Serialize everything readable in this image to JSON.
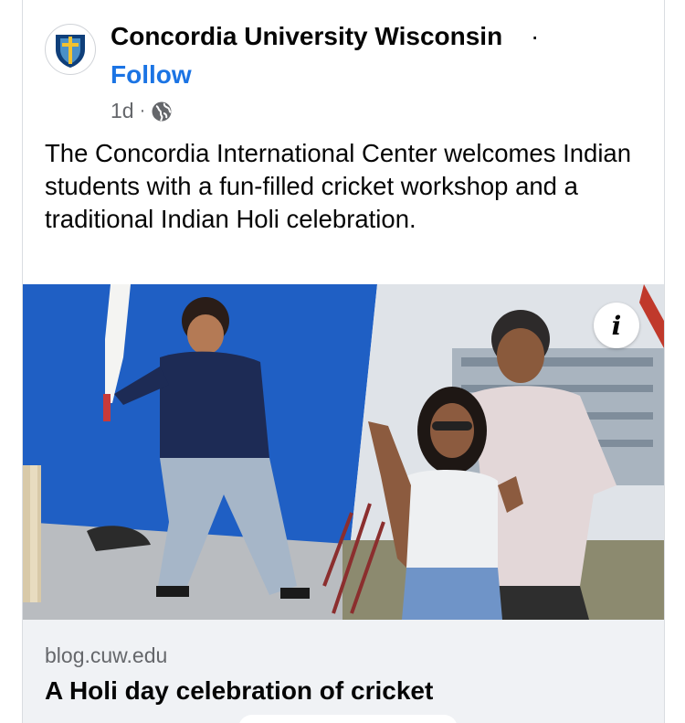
{
  "post": {
    "page_name": "Concordia University Wisconsin",
    "separator": "·",
    "follow_label": "Follow",
    "time": "1d",
    "meta_separator": "·",
    "privacy_icon": "globe-icon",
    "text": "The Concordia International Center welcomes Indian students with a fun-filled cricket workshop and a traditional Indian Holi celebration."
  },
  "photo": {
    "info_label": "i",
    "colors": {
      "backdrop_blue": "#1f5fc4",
      "sky": "#dfe3e8"
    }
  },
  "link": {
    "domain": "blog.cuw.edu",
    "title": "A Holi day celebration of cricket"
  },
  "colors": {
    "link_blue": "#1b74e4",
    "secondary_text": "#65676b",
    "preview_bg": "#f0f2f5"
  }
}
